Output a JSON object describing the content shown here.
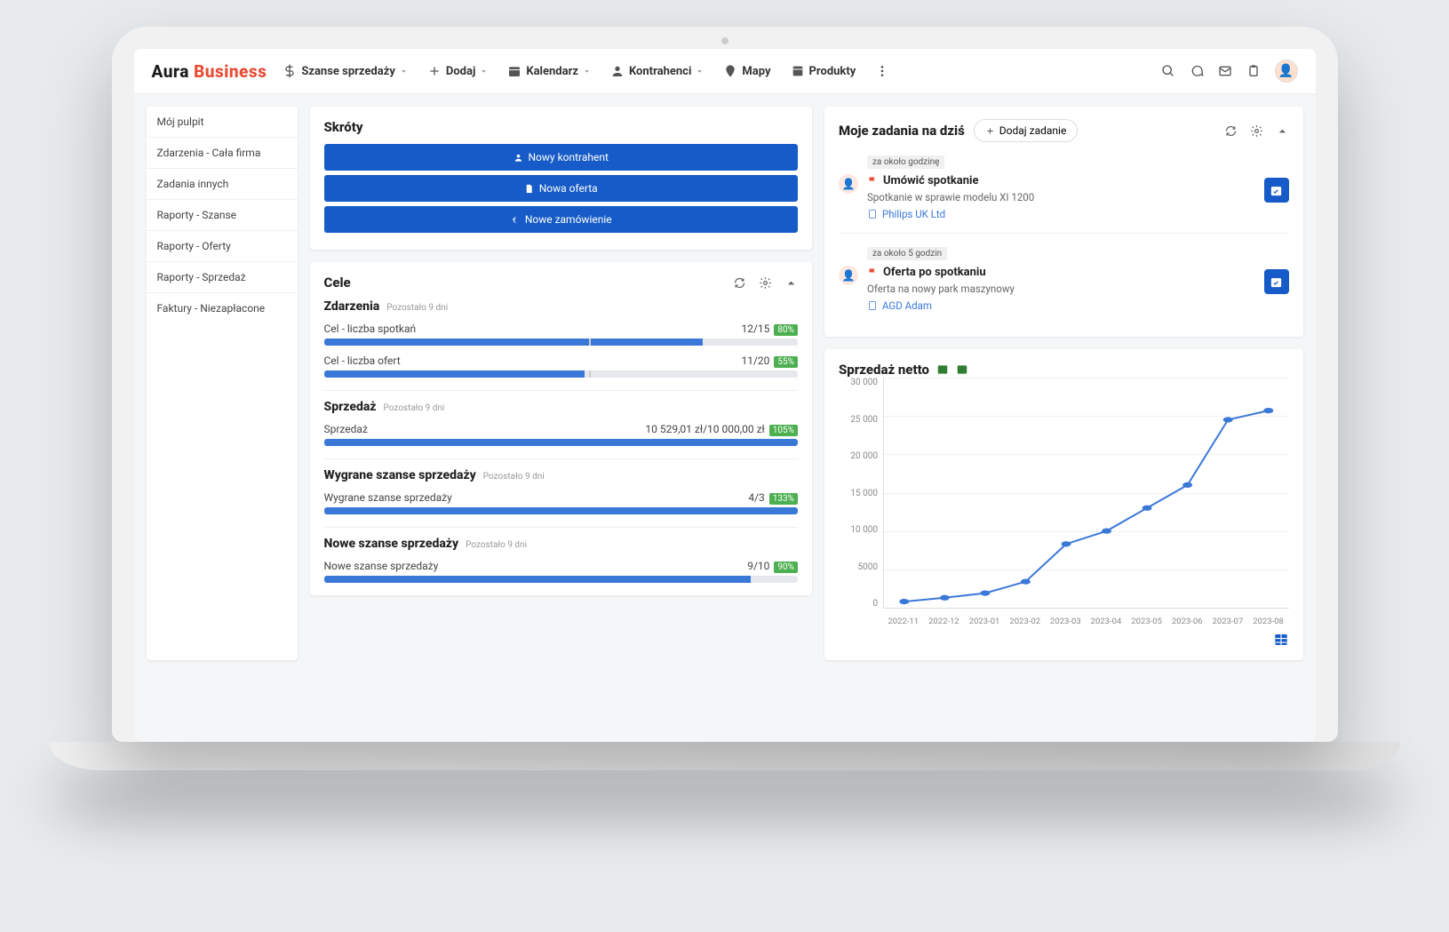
{
  "logo": {
    "part1": "Aura",
    "part2": "Business"
  },
  "nav": {
    "sales": "Szanse sprzedaży",
    "add": "Dodaj",
    "calendar": "Kalendarz",
    "contractors": "Kontrahenci",
    "maps": "Mapy",
    "products": "Produkty"
  },
  "sidebar": {
    "items": [
      "Mój pulpit",
      "Zdarzenia - Cała firma",
      "Zadania innych",
      "Raporty - Szanse",
      "Raporty - Oferty",
      "Raporty - Sprzedaż",
      "Faktury - Niezapłacone"
    ]
  },
  "shortcuts": {
    "title": "Skróty",
    "new_contractor": "Nowy kontrahent",
    "new_offer": "Nowa oferta",
    "new_order": "Nowe zamówienie"
  },
  "goals": {
    "title": "Cele",
    "sections": {
      "events": {
        "title": "Zdarzenia",
        "sub": "Pozostało 9 dni"
      },
      "sales": {
        "title": "Sprzedaż",
        "sub": "Pozostało 9 dni"
      },
      "won": {
        "title": "Wygrane szanse sprzedaży",
        "sub": "Pozostało 9 dni"
      },
      "new": {
        "title": "Nowe szanse sprzedaży",
        "sub": "Pozostało 9 dni"
      }
    },
    "rows": {
      "meetings": {
        "label": "Cel - liczba spotkań",
        "value": "12/15",
        "badge": "80%",
        "pct": 80
      },
      "offers": {
        "label": "Cel - liczba ofert",
        "value": "11/20",
        "badge": "55%",
        "pct": 55
      },
      "sales": {
        "label": "Sprzedaż",
        "value": "10 529,01 zł/10 000,00 zł",
        "badge": "105%",
        "pct": 100
      },
      "won": {
        "label": "Wygrane szanse sprzedaży",
        "value": "4/3",
        "badge": "133%",
        "pct": 100
      },
      "new": {
        "label": "Nowe szanse sprzedaży",
        "value": "9/10",
        "badge": "90%",
        "pct": 90
      }
    }
  },
  "tasks": {
    "title": "Moje zadania na dziś",
    "add_label": "Dodaj zadanie",
    "items": [
      {
        "time": "za około godzinę",
        "title": "Umówić spotkanie",
        "desc": "Spotkanie w sprawie modelu XI 1200",
        "link": "Philips UK Ltd"
      },
      {
        "time": "za około 5 godzin",
        "title": "Oferta po spotkaniu",
        "desc": "Oferta na nowy park maszynowy",
        "link": "AGD Adam"
      }
    ]
  },
  "chart": {
    "title": "Sprzedaż netto",
    "ylabels": [
      "30 000",
      "25 000",
      "20 000",
      "15 000",
      "10 000",
      "5000",
      "0"
    ]
  },
  "chart_data": {
    "type": "line",
    "title": "Sprzedaż netto",
    "xlabel": "",
    "ylabel": "",
    "ylim": [
      0,
      30000
    ],
    "categories": [
      "2022-11",
      "2022-12",
      "2023-01",
      "2023-02",
      "2023-03",
      "2023-04",
      "2023-05",
      "2023-06",
      "2023-07",
      "2023-08"
    ],
    "values": [
      800,
      1300,
      1900,
      3400,
      8300,
      10000,
      13000,
      16000,
      24500,
      25700
    ]
  }
}
